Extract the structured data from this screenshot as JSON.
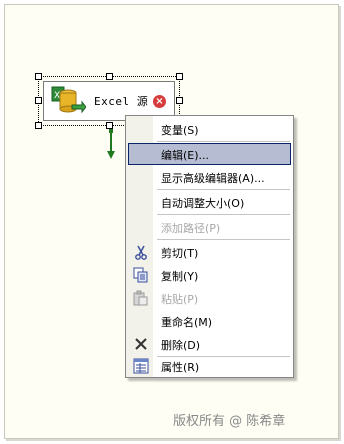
{
  "component": {
    "label": "Excel 源",
    "error_glyph": "×",
    "icons": {
      "main": "excel-source-icon",
      "status": "error-icon"
    }
  },
  "context_menu": {
    "items": [
      {
        "label": "变量(S)",
        "state": "normal",
        "icon": ""
      },
      {
        "label": "编辑(E)...",
        "state": "selected",
        "icon": ""
      },
      {
        "label": "显示高级编辑器(A)...",
        "state": "normal",
        "icon": ""
      },
      {
        "label": "自动调整大小(O)",
        "state": "normal",
        "icon": ""
      },
      {
        "label": "添加路径(P)",
        "state": "disabled",
        "icon": ""
      },
      {
        "label": "剪切(T)",
        "state": "normal",
        "icon": "scissors-icon"
      },
      {
        "label": "复制(Y)",
        "state": "normal",
        "icon": "copy-icon"
      },
      {
        "label": "粘贴(P)",
        "state": "disabled",
        "icon": "paste-icon"
      },
      {
        "label": "重命名(M)",
        "state": "normal",
        "icon": ""
      },
      {
        "label": "删除(D)",
        "state": "normal",
        "icon": "delete-icon"
      },
      {
        "label": "属性(R)",
        "state": "normal",
        "icon": "properties-icon"
      }
    ]
  },
  "watermark": "版权所有 @  陈希章",
  "colors": {
    "selection_bg": "#b6bdd2",
    "selection_border": "#0a246a",
    "disabled_text": "#a7a7a7",
    "canvas_bg": "#fefef5",
    "connector_green": "#1f7a1f"
  }
}
